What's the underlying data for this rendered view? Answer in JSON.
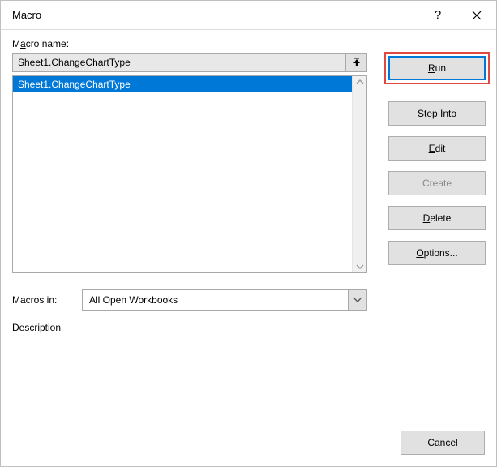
{
  "titlebar": {
    "title": "Macro"
  },
  "labels": {
    "macro_name_pre": "M",
    "macro_name_u": "a",
    "macro_name_post": "cro name:",
    "macros_in": "Macros in:",
    "description": "Description"
  },
  "fields": {
    "macro_name_value": "Sheet1.ChangeChartType",
    "macros_in_value": "All Open Workbooks"
  },
  "list": {
    "items": [
      {
        "label": "Sheet1.ChangeChartType",
        "selected": true
      }
    ]
  },
  "buttons": {
    "run_u": "R",
    "run_post": "un",
    "step_u": "S",
    "step_post": "tep Into",
    "edit_u": "E",
    "edit_post": "dit",
    "create": "Create",
    "delete_u": "D",
    "delete_post": "elete",
    "options_u": "O",
    "options_post": "ptions...",
    "cancel": "Cancel"
  }
}
